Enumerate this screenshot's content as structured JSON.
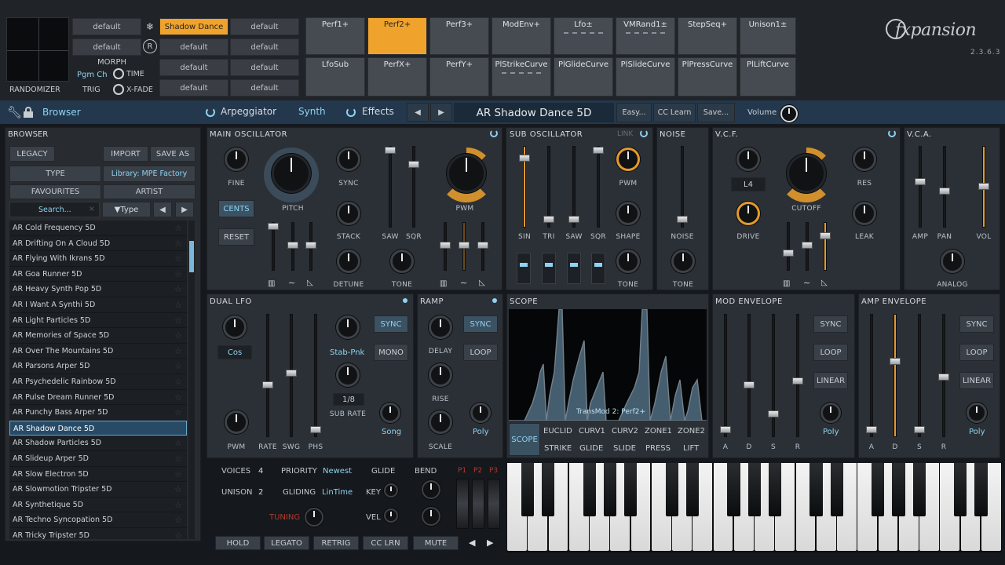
{
  "header": {
    "randomizer_label": "RANDOMIZER",
    "morph_label": "MORPH",
    "pgmch_label": "Pgm Ch",
    "time_label": "TIME",
    "trig_label": "TRIG",
    "xfade_label": "X-FADE",
    "preset_slots": [
      "default",
      "Shadow Dance",
      "default",
      "default",
      "default",
      "default",
      "default",
      "default",
      "default",
      "default"
    ],
    "perf_top": [
      "Perf1+",
      "Perf2+",
      "Perf3+",
      "ModEnv+",
      "Lfo±",
      "VMRand1±",
      "StepSeq+",
      "Unison1±"
    ],
    "perf_bottom": [
      "LfoSub",
      "PerfX+",
      "PerfY+",
      "PlStrikeCurve",
      "PlGlideCurve",
      "PlSlideCurve",
      "PlPressCurve",
      "PlLiftCurve"
    ],
    "logo": "fxpansion",
    "version": "2.3.6.3"
  },
  "toolbar": {
    "browser": "Browser",
    "arpeggiator": "Arpeggiator",
    "synth": "Synth",
    "effects": "Effects",
    "preset_name": "AR Shadow Dance 5D",
    "easy": "Easy...",
    "cc_learn": "CC Learn",
    "save": "Save...",
    "volume": "Volume"
  },
  "browser": {
    "title": "BROWSER",
    "legacy": "LEGACY",
    "import": "IMPORT",
    "save_as": "SAVE AS",
    "type": "TYPE",
    "library": "Library: MPE Factory",
    "favourites": "FAVOURITES",
    "artist": "ARTIST",
    "search_placeholder": "Search...",
    "type_filter": "▼Type",
    "items": [
      "AR Cold Frequency 5D",
      "AR Drifting On A Cloud 5D",
      "AR Flying With Ikrans 5D",
      "AR Goa Runner 5D",
      "AR Heavy Synth Pop 5D",
      "AR I Want A Synthi 5D",
      "AR Light Particles 5D",
      "AR Memories of Space 5D",
      "AR Over The Mountains 5D",
      "AR Parsons Arper 5D",
      "AR Psychedelic Rainbow 5D",
      "AR Pulse Dream Runner 5D",
      "AR Punchy Bass Arper 5D",
      "AR Shadow Dance 5D",
      "AR Shadow Particles 5D",
      "AR Slideup Arper 5D",
      "AR Slow Electron 5D",
      "AR Slowmotion Tripster 5D",
      "AR Synthetique 5D",
      "AR Techno Syncopation 5D",
      "AR Tricky Tripster 5D"
    ],
    "selected_index": 13
  },
  "main_osc": {
    "title": "MAIN OSCILLATOR",
    "fine": "FINE",
    "pitch": "PITCH",
    "sync": "SYNC",
    "cents": "CENTS",
    "reset": "RESET",
    "stack": "STACK",
    "detune": "DETUNE",
    "saw": "SAW",
    "sqr": "SQR",
    "tone": "TONE",
    "pwm": "PWM"
  },
  "sub_osc": {
    "title": "SUB OSCILLATOR",
    "link": "LINK",
    "pwm": "PWM",
    "shape": "SHAPE",
    "tone": "TONE",
    "sin": "SIN",
    "tri": "TRI",
    "saw": "SAW",
    "sqr": "SQR"
  },
  "noise": {
    "title": "NOISE",
    "noise": "NOISE",
    "tone": "TONE"
  },
  "vcf": {
    "title": "V.C.F.",
    "mode": "L4",
    "cutoff": "CUTOFF",
    "res": "RES",
    "drive": "DRIVE",
    "leak": "LEAK"
  },
  "vca": {
    "title": "V.C.A.",
    "amp": "AMP",
    "pan": "PAN",
    "vol": "VOL",
    "analog": "ANALOG"
  },
  "lfo": {
    "title": "DUAL LFO",
    "wave1": "Cos",
    "wave2": "Stab-Pnk",
    "sync": "SYNC",
    "mono": "MONO",
    "rate_val": "1/8",
    "sub_rate": "SUB RATE",
    "song": "Song",
    "pwm": "PWM",
    "rate": "RATE",
    "swg": "SWG",
    "phs": "PHS"
  },
  "ramp": {
    "title": "RAMP",
    "delay": "DELAY",
    "sync": "SYNC",
    "loop": "LOOP",
    "rise": "RISE",
    "scale": "SCALE",
    "poly": "Poly"
  },
  "scope": {
    "title": "SCOPE",
    "caption": "TransMod 2: Perf2+",
    "tabs_top": [
      "SCOPE",
      "EUCLID",
      "CURV1",
      "CURV2",
      "ZONE1",
      "ZONE2"
    ],
    "tabs_bottom": [
      "STRIKE",
      "GLIDE",
      "SLIDE",
      "PRESS",
      "LIFT"
    ]
  },
  "mod_env": {
    "title": "MOD ENVELOPE",
    "sync": "SYNC",
    "loop": "LOOP",
    "linear": "LINEAR",
    "poly": "Poly",
    "a": "A",
    "d": "D",
    "s": "S",
    "r": "R"
  },
  "amp_env": {
    "title": "AMP ENVELOPE",
    "sync": "SYNC",
    "loop": "LOOP",
    "linear": "LINEAR",
    "poly": "Poly",
    "a": "A",
    "d": "D",
    "s": "S",
    "r": "R"
  },
  "voice": {
    "voices_label": "VOICES",
    "voices": "4",
    "priority_label": "PRIORITY",
    "priority": "Newest",
    "glide": "GLIDE",
    "bend": "BEND",
    "unison_label": "UNISON",
    "unison": "2",
    "gliding_label": "GLIDING",
    "gliding": "LinTime",
    "key": "KEY",
    "vel": "VEL",
    "tuning": "TUNING",
    "p1": "P1",
    "p2": "P2",
    "p3": "P3",
    "hold": "HOLD",
    "legato": "LEGATO",
    "retrig": "RETRIG",
    "cc_lrn": "CC LRN",
    "mute": "MUTE"
  },
  "colors": {
    "accent": "#f0a32c",
    "blue": "#8fd3f2",
    "panel": "#2b3036"
  }
}
